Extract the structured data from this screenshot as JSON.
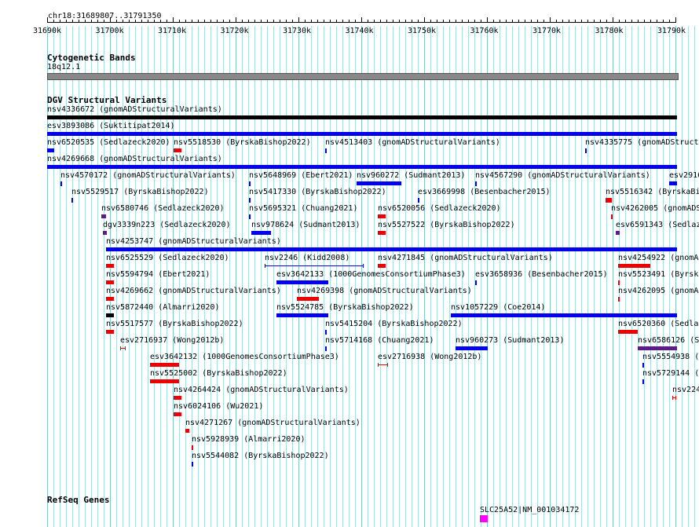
{
  "locus": "chr18:31689807..31791350",
  "ruler": {
    "ticks": [
      "31690k",
      "31700k",
      "31710k",
      "31720k",
      "31730k",
      "31740k",
      "31750k",
      "31760k",
      "31770k",
      "31780k",
      "31790k"
    ]
  },
  "tracks": {
    "cytoband": {
      "title": "Cytogenetic Bands",
      "band": "18q12.1"
    },
    "dgv": {
      "title": "DGV Structural Variants"
    },
    "refseq": {
      "title": "RefSeq Genes"
    }
  },
  "colors": {
    "gain": "#0000ee",
    "loss": "#ee0000",
    "both": "#5c1a8c",
    "ambiguous": "#000000",
    "refseq": "#ff00ff",
    "grid": "#a6dde6"
  },
  "features": [
    {
      "label": "nsv4336672 (gnomADStructuralVariants)",
      "color": "ambiguous"
    },
    {
      "label": "esv3893086 (Suktitipat2014)",
      "color": "gain"
    },
    {
      "label": "nsv6520535 (Sedlazeck2020)",
      "color": "gain"
    },
    {
      "label": "nsv5518530 (ByrskaBishop2022)",
      "color": "loss"
    },
    {
      "label": "nsv4513403 (gnomADStructuralVariants)",
      "color": "gain"
    },
    {
      "label": "nsv4335775 (gnomADStructu",
      "color": "gain"
    },
    {
      "label": "nsv4269668 (gnomADStructuralVariants)",
      "color": "gain"
    },
    {
      "label": "nsv4570172 (gnomADStructuralVariants)",
      "color": "gain"
    },
    {
      "label": "nsv5648969 (Ebert2021)",
      "color": "gain"
    },
    {
      "label": "nsv960272 (Sudmant2013)",
      "color": "gain"
    },
    {
      "label": "nsv4567290 (gnomADStructuralVariants)",
      "color": "gain"
    },
    {
      "label": "esv2916",
      "color": "gain"
    },
    {
      "label": "nsv5529517 (ByrskaBishop2022)",
      "color": "gain"
    },
    {
      "label": "nsv5417330 (ByrskaBishop2022)",
      "color": "gain"
    },
    {
      "label": "esv3669998 (Besenbacher2015)",
      "color": "gain"
    },
    {
      "label": "nsv5516342 (ByrskaBi",
      "color": "loss"
    },
    {
      "label": "nsv6580746 (Sedlazeck2020)",
      "color": "both"
    },
    {
      "label": "nsv5695321 (Chuang2021)",
      "color": "gain"
    },
    {
      "label": "nsv6520056 (Sedlazeck2020)",
      "color": "loss"
    },
    {
      "label": "nsv4262005 (gnomADS",
      "color": "loss"
    },
    {
      "label": "dgv3339n223 (Sedlazeck2020)",
      "color": "both"
    },
    {
      "label": "nsv978624 (Sudmant2013)",
      "color": "gain"
    },
    {
      "label": "nsv5527522 (ByrskaBishop2022)",
      "color": "loss"
    },
    {
      "label": "esv6591343 (Sedlaz",
      "color": "both"
    },
    {
      "label": "nsv4253747 (gnomADStructuralVariants)",
      "color": "gain"
    },
    {
      "label": "nsv6525529 (Sedlazeck2020)",
      "color": "loss"
    },
    {
      "label": "nsv2246 (Kidd2008)",
      "color": "gain"
    },
    {
      "label": "nsv4271845 (gnomADStructuralVariants)",
      "color": "loss"
    },
    {
      "label": "nsv4254922 (gnomAD",
      "color": "loss"
    },
    {
      "label": "nsv5594794 (Ebert2021)",
      "color": "loss"
    },
    {
      "label": "esv3642133 (1000GenomesConsortiumPhase3)",
      "color": "gain"
    },
    {
      "label": "esv3658936 (Besenbacher2015)",
      "color": "gain"
    },
    {
      "label": "nsv5523491 (Byrsk",
      "color": "loss"
    },
    {
      "label": "nsv4269662 (gnomADStructuralVariants)",
      "color": "loss"
    },
    {
      "label": "nsv4269398 (gnomADStructuralVariants)",
      "color": "loss"
    },
    {
      "label": "nsv4262095 (gnomADS",
      "color": "loss"
    },
    {
      "label": "nsv5872440 (Almarri2020)",
      "color": "ambiguous"
    },
    {
      "label": "nsv5524785 (ByrskaBishop2022)",
      "color": "gain"
    },
    {
      "label": "nsv1057229 (Coe2014)",
      "color": "gain"
    },
    {
      "label": "nsv5517577 (ByrskaBishop2022)",
      "color": "loss"
    },
    {
      "label": "nsv5415204 (ByrskaBishop2022)",
      "color": "gain"
    },
    {
      "label": "nsv6520360 (Sedla",
      "color": "loss"
    },
    {
      "label": "esv2716937 (Wong2012b)",
      "color": "loss"
    },
    {
      "label": "nsv5714168 (Chuang2021)",
      "color": "gain"
    },
    {
      "label": "nsv960273 (Sudmant2013)",
      "color": "gain"
    },
    {
      "label": "nsv6586126 (S",
      "color": "both"
    },
    {
      "label": "esv3642132 (1000GenomesConsortiumPhase3)",
      "color": "loss"
    },
    {
      "label": "esv2716938 (Wong2012b)",
      "color": "loss"
    },
    {
      "label": "nsv5554938 (",
      "color": "gain"
    },
    {
      "label": "nsv5525002 (ByrskaBishop2022)",
      "color": "loss"
    },
    {
      "label": "nsv5729144 (",
      "color": "gain"
    },
    {
      "label": "nsv4264424 (gnomADStructuralVariants)",
      "color": "loss"
    },
    {
      "label": "nsv224",
      "color": "loss"
    },
    {
      "label": "nsv6024106 (Wu2021)",
      "color": "loss"
    },
    {
      "label": "nsv4271267 (gnomADStructuralVariants)",
      "color": "loss"
    },
    {
      "label": "nsv5928939 (Almarri2020)",
      "color": "loss"
    },
    {
      "label": "nsv5544082 (ByrskaBishop2022)",
      "color": "gain"
    },
    {
      "label": "SLC25A52|NM_001034172",
      "color": "refseq"
    }
  ]
}
